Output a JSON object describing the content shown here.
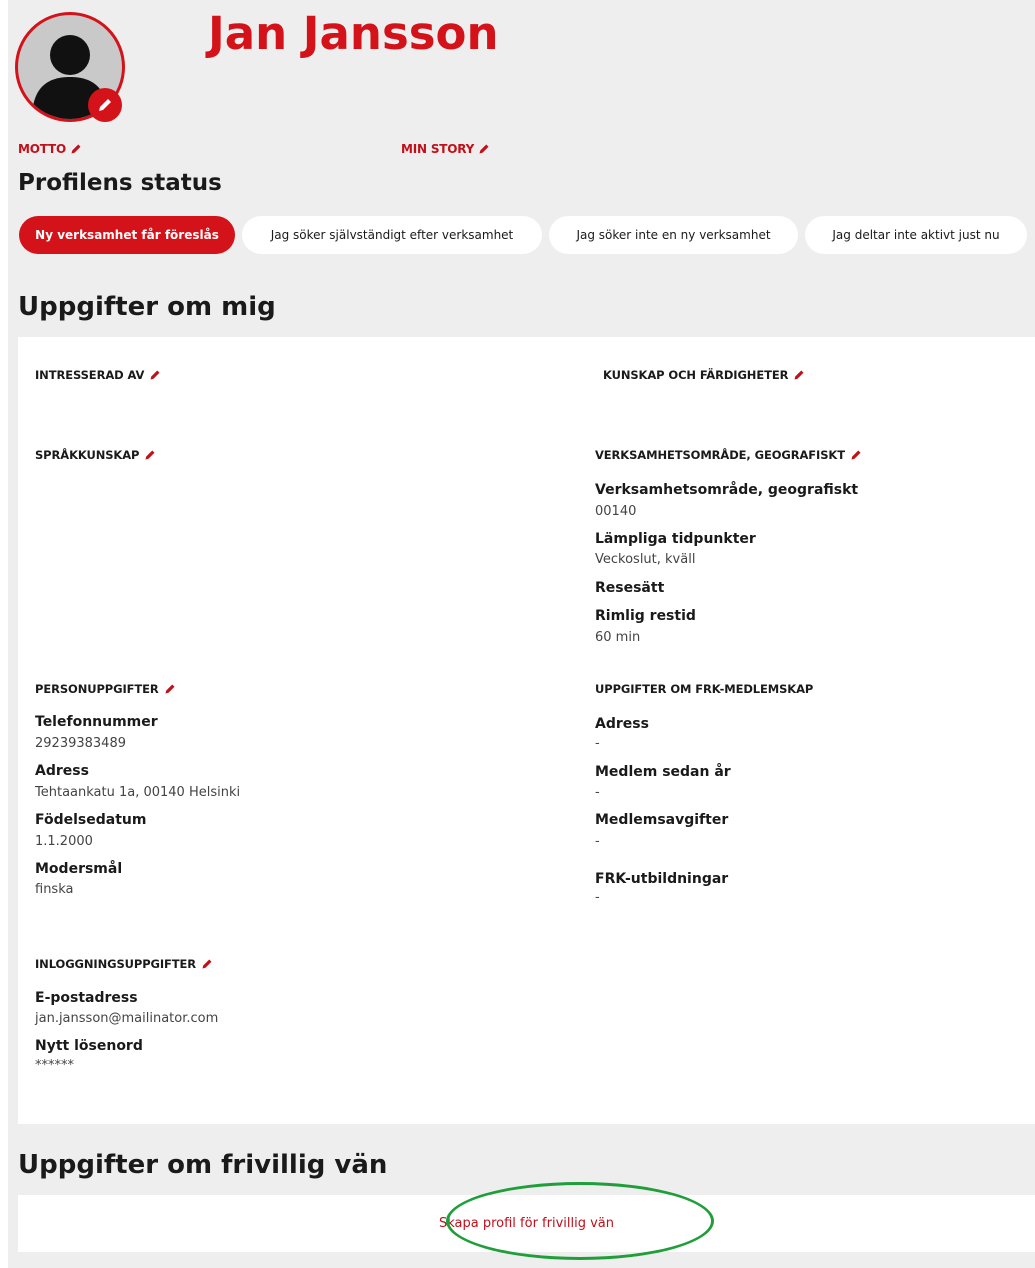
{
  "profile": {
    "name": "Jan Jansson",
    "motto_label": "MOTTO",
    "story_label": "MIN STORY"
  },
  "status": {
    "title": "Profilens status",
    "options": [
      {
        "label": "Ny verksamhet får föreslås",
        "active": true
      },
      {
        "label": "Jag söker självständigt efter verksamhet",
        "active": false
      },
      {
        "label": "Jag söker inte en ny verksamhet",
        "active": false
      },
      {
        "label": "Jag deltar inte aktivt just nu",
        "active": false
      }
    ]
  },
  "about": {
    "title": "Uppgifter om mig",
    "interested_header": "INTRESSERAD AV",
    "skills_header": "KUNSKAP OCH FÄRDIGHETER",
    "languages_header": "SPRÅKKUNSKAP",
    "area": {
      "header": "VERKSAMHETSOMRÅDE, GEOGRAFISKT",
      "area_label": "Verksamhetsområde, geografiskt",
      "area_value": "00140",
      "times_label": "Lämpliga tidpunkter",
      "times_value": "Veckoslut, kväll",
      "travel_label": "Resesätt",
      "traveltime_label": "Rimlig restid",
      "traveltime_value": "60 min"
    },
    "personal": {
      "header": "PERSONUPPGIFTER",
      "phone_label": "Telefonnummer",
      "phone_value": "29239383489",
      "address_label": "Adress",
      "address_value": "Tehtaankatu 1a, 00140 Helsinki",
      "birth_label": "Födelsedatum",
      "birth_value": "1.1.2000",
      "language_label": "Modersmål",
      "language_value": "finska"
    },
    "membership": {
      "header": "UPPGIFTER OM FRK-MEDLEMSKAP",
      "address_label": "Adress",
      "address_value": "-",
      "since_label": "Medlem sedan år",
      "since_value": "-",
      "fees_label": "Medlemsavgifter",
      "fees_value": "-",
      "training_label": "FRK-utbildningar",
      "training_value": "-"
    },
    "login": {
      "header": "INLOGGNINGSUPPGIFTER",
      "email_label": "E-postadress",
      "email_value": "jan.jansson@mailinator.com",
      "password_label": "Nytt lösenord",
      "password_value": "******"
    }
  },
  "friend": {
    "title": "Uppgifter om frivillig vän",
    "create_link": "Skapa profil för frivillig vän"
  },
  "colors": {
    "brand_red": "#d3121a",
    "highlight_green": "#1f9e3a",
    "page_bg": "#eeeeee"
  },
  "icons": [
    "avatar-placeholder-icon",
    "pencil-icon"
  ]
}
